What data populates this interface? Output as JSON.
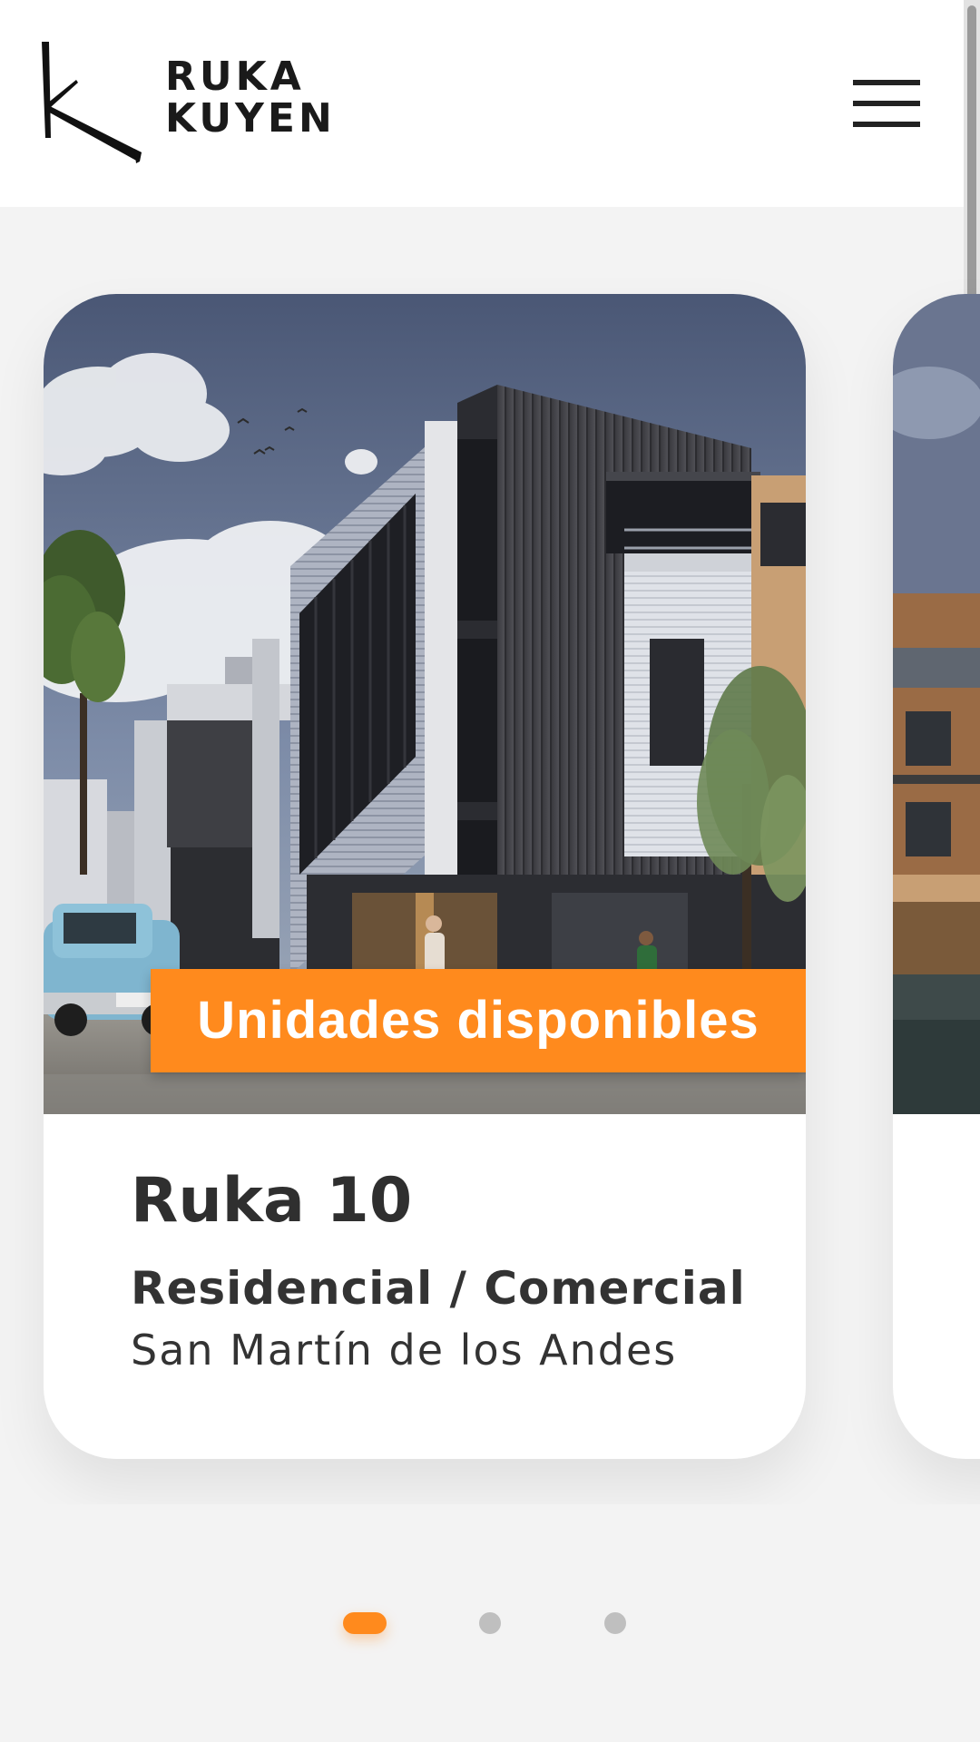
{
  "brand": {
    "line1": "RUKA",
    "line2": "KUYEN",
    "logo_icon": "k-monogram-icon"
  },
  "header": {
    "menu_icon": "hamburger-menu-icon"
  },
  "carousel": {
    "cards": [
      {
        "badge": "Unidades disponibles",
        "title": "Ruka 10",
        "type": "Residencial / Comercial",
        "location": "San Martín de los Andes"
      }
    ],
    "pages": 3,
    "active_page": 1
  },
  "colors": {
    "accent": "#ff8a1d",
    "text": "#2f2f2f",
    "background": "#f3f3f3",
    "card": "#ffffff",
    "dot_inactive": "#bfbfbf"
  }
}
